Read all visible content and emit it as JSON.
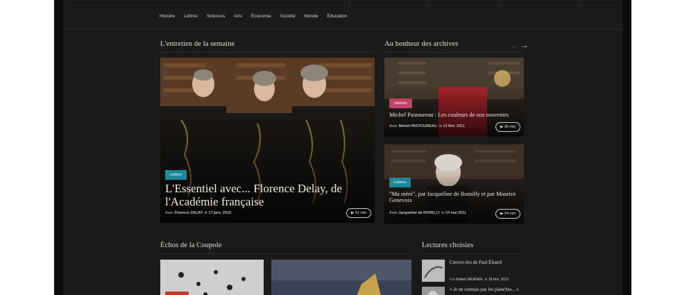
{
  "nav": {
    "items": [
      "Histoire",
      "Lettres",
      "Sciences",
      "Arts",
      "Économie",
      "Société",
      "Monde",
      "Éducation"
    ]
  },
  "interview": {
    "section_title": "L'entretien de la semaine",
    "badge": "Lettres",
    "title": "L'Essentiel avec... Florence Delay, de l'Académie française",
    "by": "Avec",
    "person": "Florence DELAY",
    "date_prefix": ", le",
    "date": "17 janv. 2010",
    "duration": "41 min"
  },
  "archives": {
    "section_title": "Au bonheur des archives",
    "prev_icon": "arrow-left-icon",
    "next_icon": "arrow-right-icon",
    "items": [
      {
        "badge": "Histoire",
        "title": "Michel Pastoureau : Les couleurs de nos souvenirs",
        "by": "Avec",
        "person": "Michel PASTOUREAU",
        "date_prefix": ", le",
        "date": "13 févr. 2011",
        "duration": "36 min"
      },
      {
        "badge": "Lettres",
        "title": "\"Ma mère\", par Jacqueline de Romilly et par Maurice Genevoix",
        "by": "Avec",
        "person": "Jacqueline de ROMILLY",
        "date_prefix": ", le",
        "date": "24 mai 2011",
        "duration": "24 min"
      }
    ]
  },
  "echos": {
    "section_title": "Échos de la Coupole"
  },
  "readings": {
    "section_title": "Lectures choisies",
    "items": [
      {
        "title": "Couvre-feu de Paul Éluard",
        "by": "Par",
        "person": "Robert WERNER",
        "date_prefix": ", le",
        "date": "18 févr. 2019"
      },
      {
        "title": "« Je ne connais pas les planches... »"
      }
    ]
  },
  "colors": {
    "background": "#1a1a1a",
    "teal_badge": "#1d8a9a",
    "pink_badge": "#c2416d",
    "text_light": "#e8e3d8"
  }
}
